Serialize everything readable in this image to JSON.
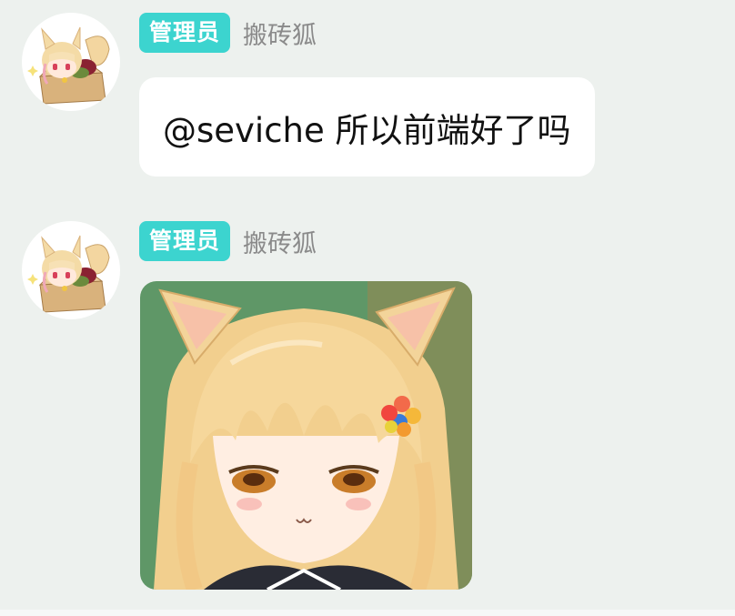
{
  "messages": [
    {
      "role_badge": "管理员",
      "username": "搬砖狐",
      "avatar_icon": "fox-girl-in-box-avatar",
      "type": "text",
      "text": "@seviche 所以前端好了吗"
    },
    {
      "role_badge": "管理员",
      "username": "搬砖狐",
      "avatar_icon": "fox-girl-in-box-avatar",
      "type": "image",
      "image_icon": "fox-girl-sticker-image"
    }
  ],
  "colors": {
    "background": "#edf1ee",
    "badge": "#3cd4cf",
    "username": "#8a8a8a",
    "bubble": "#ffffff"
  }
}
